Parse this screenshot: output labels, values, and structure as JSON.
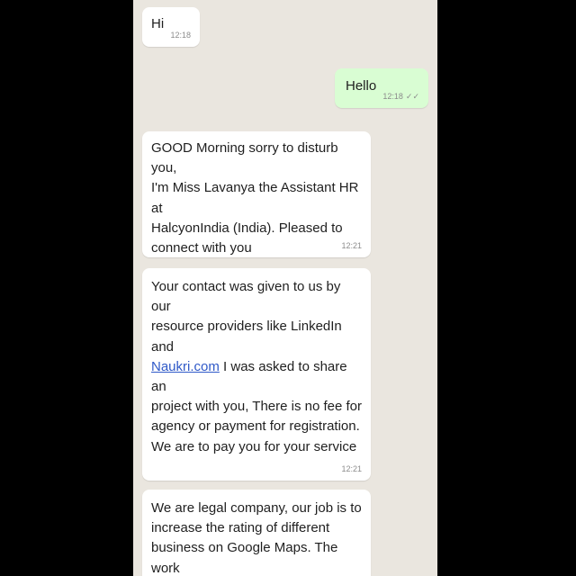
{
  "messages": [
    {
      "dir": "in",
      "text": "Hi",
      "time": "12:18"
    },
    {
      "dir": "out",
      "text": "Hello",
      "time": "12:18"
    },
    {
      "dir": "in",
      "text": "GOOD Morning sorry to disturb you,\nI'm Miss Lavanya the Assistant HR at\nHalcyonIndia (India). Pleased to\nconnect with you",
      "time": "12:21"
    },
    {
      "dir": "in",
      "pre": "Your contact was given to us by our\nresource providers like LinkedIn and\n",
      "link": "Naukri.com",
      "post": " I was asked to share an\nproject with you, There is no fee for\nagency or payment for registration.\nWe are to pay you for your service",
      "time": "12:21"
    },
    {
      "dir": "in",
      "text": "We are legal company, our job is to\nincrease the rating of different\nbusiness on Google Maps. The work",
      "time": ""
    }
  ]
}
